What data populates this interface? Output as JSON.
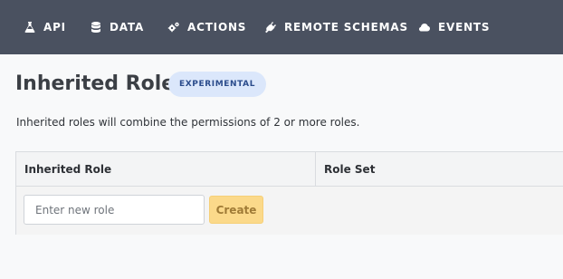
{
  "topnav": {
    "items": [
      {
        "label": "API",
        "icon": "flask-icon"
      },
      {
        "label": "DATA",
        "icon": "database-icon"
      },
      {
        "label": "ACTIONS",
        "icon": "cogs-icon"
      },
      {
        "label": "REMOTE SCHEMAS",
        "icon": "plug-icon"
      },
      {
        "label": "EVENTS",
        "icon": "cloud-icon"
      }
    ]
  },
  "page": {
    "title": "Inherited Roles",
    "badge": "EXPERIMENTAL",
    "description": "Inherited roles will combine the permissions of 2 or more roles."
  },
  "table": {
    "columns": [
      "Inherited Role",
      "Role Set"
    ],
    "new_role_input": {
      "placeholder": "Enter new role",
      "value": ""
    },
    "create_label": "Create"
  }
}
